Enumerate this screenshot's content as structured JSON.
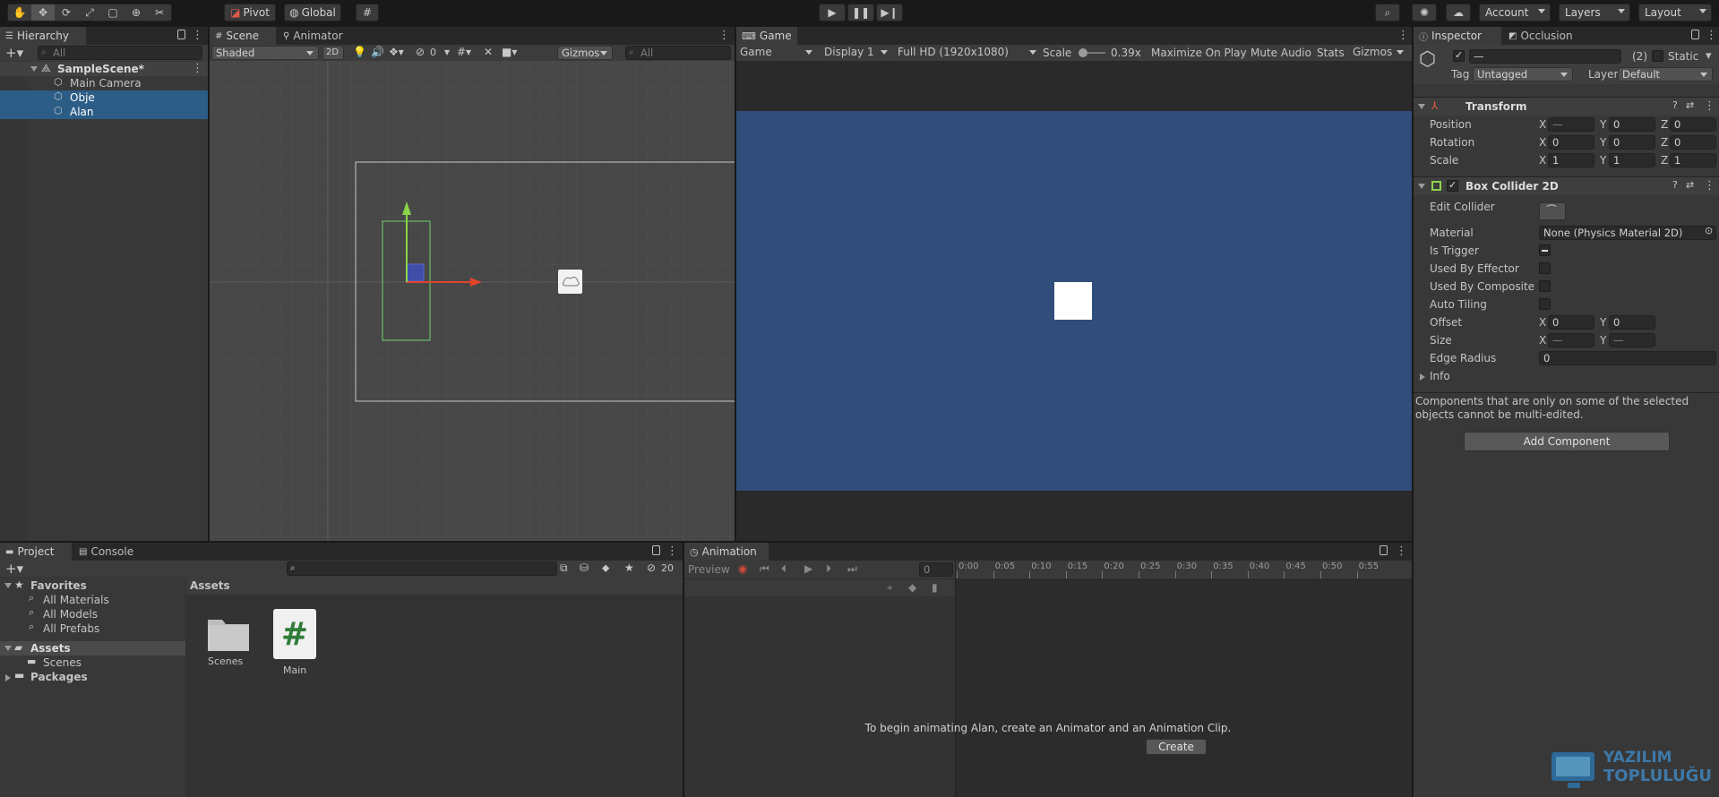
{
  "toolbar": {
    "pivot_label": "Pivot",
    "global_label": "Global",
    "account_label": "Account",
    "layers_label": "Layers",
    "layout_label": "Layout"
  },
  "hierarchy": {
    "tab_label": "Hierarchy",
    "search_placeholder": "All",
    "scene_name": "SampleScene*",
    "items": [
      {
        "label": "Main Camera",
        "selected": false
      },
      {
        "label": "Obje",
        "selected": true
      },
      {
        "label": "Alan",
        "selected": true
      }
    ]
  },
  "scene": {
    "tab_scene": "Scene",
    "tab_animator": "Animator",
    "shading": "Shaded",
    "mode_2d": "2D",
    "hidden_count": "0",
    "gizmos_label": "Gizmos",
    "search_placeholder": "All"
  },
  "game": {
    "tab_label": "Game",
    "view_select": "Game",
    "display_select": "Display 1",
    "resolution_select": "Full HD (1920x1080)",
    "scale_label": "Scale",
    "scale_value": "0.39x",
    "maximize_label": "Maximize On Play",
    "mute_label": "Mute Audio",
    "stats_label": "Stats",
    "gizmos_label": "Gizmos",
    "background_color": "#314d79"
  },
  "inspector": {
    "tab_inspector": "Inspector",
    "tab_occlusion": "Occlusion",
    "name_value": "—",
    "count_badge": "(2)",
    "static_label": "Static",
    "tag_label": "Tag",
    "tag_value": "Untagged",
    "layer_label": "Layer",
    "layer_value": "Default",
    "transform": {
      "title": "Transform",
      "rows": [
        {
          "label": "Position",
          "x": "—",
          "y": "0",
          "z": "0"
        },
        {
          "label": "Rotation",
          "x": "0",
          "y": "0",
          "z": "0"
        },
        {
          "label": "Scale",
          "x": "1",
          "y": "1",
          "z": "1"
        }
      ]
    },
    "collider": {
      "title": "Box Collider 2D",
      "edit_label": "Edit Collider",
      "material_label": "Material",
      "material_value": "None (Physics Material 2D)",
      "is_trigger_label": "Is Trigger",
      "effector_label": "Used By Effector",
      "composite_label": "Used By Composite",
      "autotiling_label": "Auto Tiling",
      "offset_label": "Offset",
      "offset_x": "0",
      "offset_y": "0",
      "size_label": "Size",
      "size_x": "—",
      "size_y": "—",
      "edge_label": "Edge Radius",
      "edge_value": "0",
      "info_label": "Info"
    },
    "multi_edit_note": "Components that are only on some of the selected objects cannot be multi-edited.",
    "add_component": "Add Component",
    "axis_x": "X",
    "axis_y": "Y",
    "axis_z": "Z"
  },
  "project": {
    "tab_project": "Project",
    "tab_console": "Console",
    "hidden_count": "20",
    "favorites_label": "Favorites",
    "favorites": [
      "All Materials",
      "All Models",
      "All Prefabs"
    ],
    "assets_label": "Assets",
    "assets_children": [
      "Scenes"
    ],
    "packages_label": "Packages",
    "breadcrumb": "Assets",
    "files": [
      {
        "name": "Scenes",
        "icon": "folder-icon"
      },
      {
        "name": "Main",
        "icon": "csharp-script-icon"
      }
    ]
  },
  "animation": {
    "tab_label": "Animation",
    "preview_label": "Preview",
    "frame_value": "0",
    "timeline_ticks": [
      "0:00",
      "0:05",
      "0:10",
      "0:15",
      "0:20",
      "0:25",
      "0:30",
      "0:35",
      "0:40",
      "0:45",
      "0:50",
      "0:55"
    ],
    "message": "To begin animating Alan, create an Animator and an Animation Clip.",
    "create_label": "Create"
  },
  "watermark": {
    "line1": "YAZILIM",
    "line2": "TOPLULUĞU"
  }
}
